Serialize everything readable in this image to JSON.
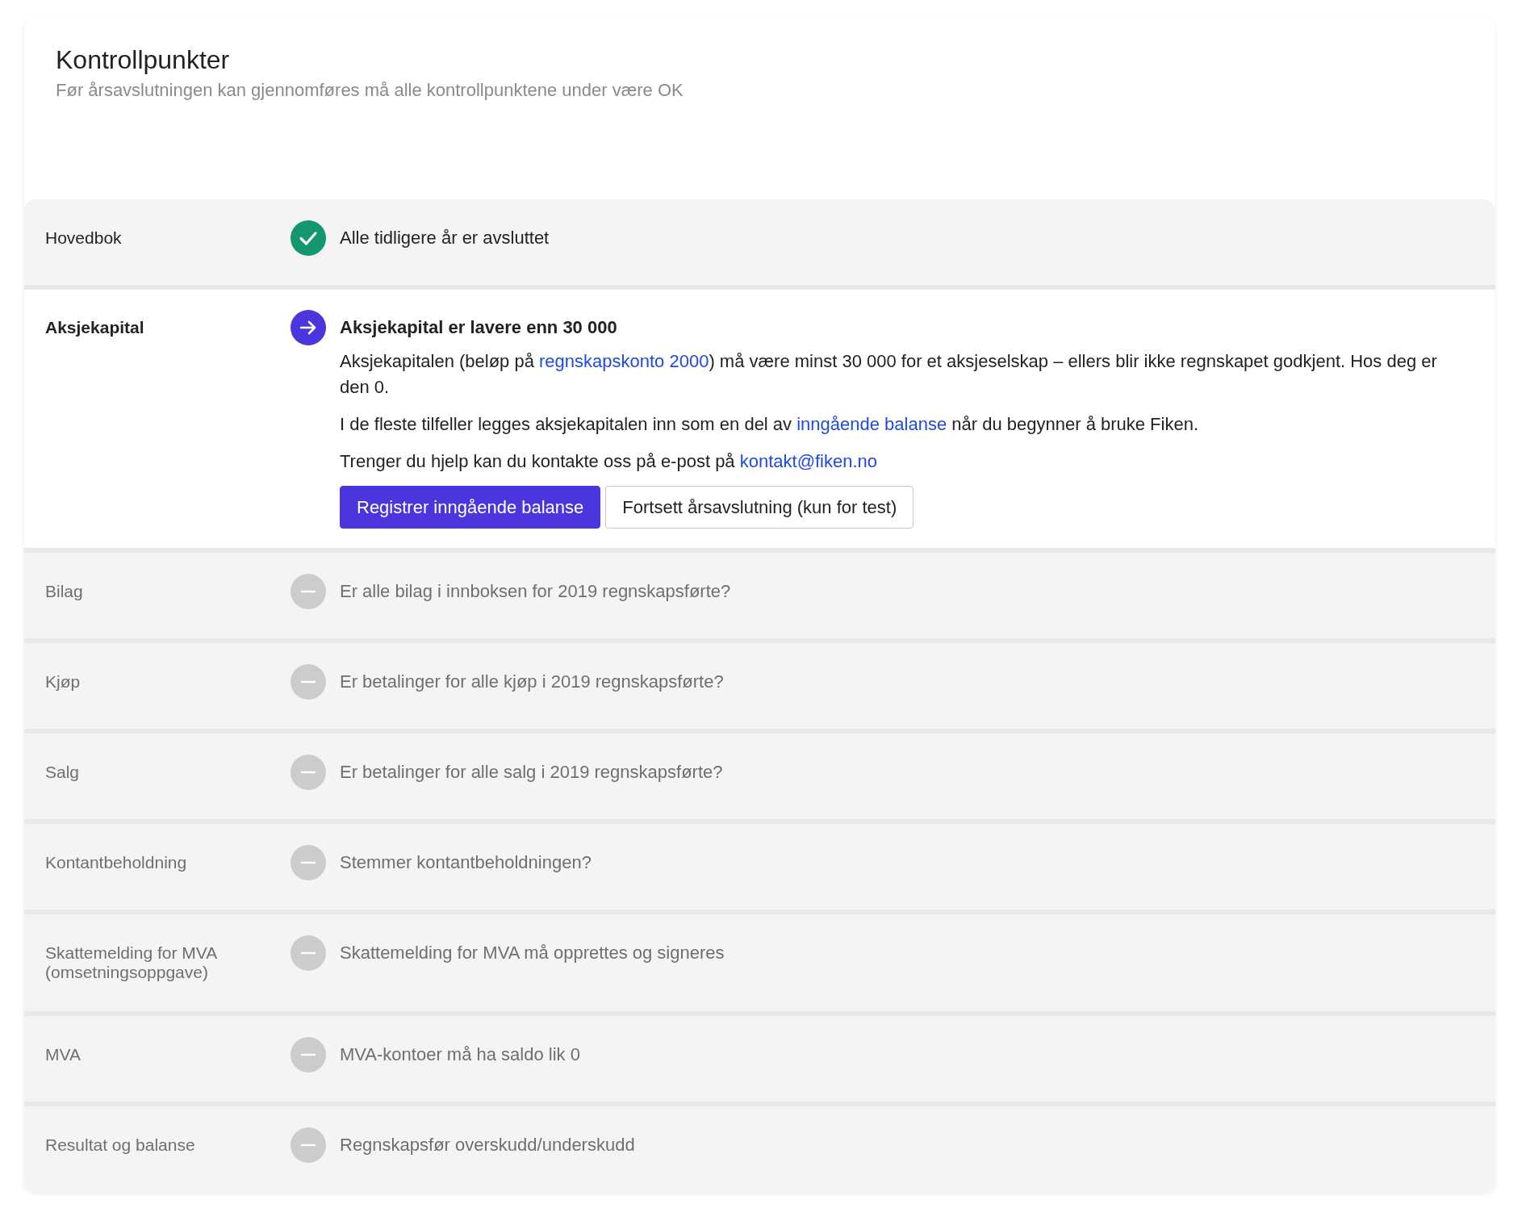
{
  "header": {
    "title": "Kontrollpunkter",
    "subtitle": "Før årsavslutningen kan gjennomføres må alle kontrollpunktene under være OK"
  },
  "checkpoints": [
    {
      "label": "Hovedbok",
      "kind": "done",
      "headline": "Alle tidligere år er avsluttet"
    },
    {
      "label": "Aksjekapital",
      "kind": "action",
      "headline": "Aksjekapital er lavere enn 30 000",
      "paragraphs": [
        [
          {
            "kind": "text",
            "text": "Aksjekapitalen (beløp på "
          },
          {
            "kind": "link",
            "text": "regnskapskonto 2000"
          },
          {
            "kind": "text",
            "text": ") må være minst 30 000 for et aksjeselskap – ellers blir ikke regnskapet godkjent. Hos deg er den 0."
          }
        ],
        [
          {
            "kind": "text",
            "text": "I de fleste tilfeller legges aksjekapitalen inn som en del av "
          },
          {
            "kind": "link",
            "text": "inngående balanse"
          },
          {
            "kind": "text",
            "text": " når du begynner å bruke Fiken."
          }
        ],
        [
          {
            "kind": "text",
            "text": "Trenger du hjelp kan du kontakte oss på e-post på "
          },
          {
            "kind": "link",
            "text": "kontakt@fiken.no"
          }
        ]
      ],
      "buttons": [
        {
          "kind": "primary",
          "label": "Registrer inngående balanse"
        },
        {
          "kind": "secondary",
          "label": "Fortsett årsavslutning (kun for test)"
        }
      ]
    },
    {
      "label": "Bilag",
      "kind": "pending",
      "headline": "Er alle bilag i innboksen for 2019 regnskapsførte?"
    },
    {
      "label": "Kjøp",
      "kind": "pending",
      "headline": "Er betalinger for alle kjøp i 2019 regnskapsførte?"
    },
    {
      "label": "Salg",
      "kind": "pending",
      "headline": "Er betalinger for alle salg i 2019 regnskapsførte?"
    },
    {
      "label": "Kontantbeholdning",
      "kind": "pending",
      "headline": "Stemmer kontantbeholdningen?"
    },
    {
      "label": "Skattemelding for MVA (omsetningsoppgave)",
      "kind": "pending",
      "headline": "Skattemelding for MVA må opprettes og signeres"
    },
    {
      "label": "MVA",
      "kind": "pending",
      "headline": "MVA-kontoer må ha saldo lik 0"
    },
    {
      "label": "Resultat og balanse",
      "kind": "pending",
      "headline": "Regnskapsfør overskudd/underskudd"
    }
  ]
}
